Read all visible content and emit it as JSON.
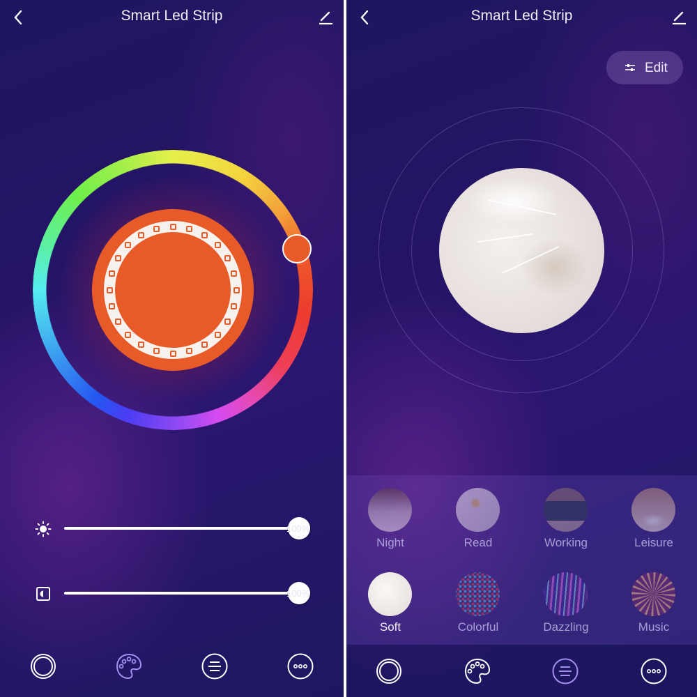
{
  "left": {
    "header": {
      "title": "Smart Led Strip",
      "back_icon": "chevron-left-icon",
      "edit_icon": "pencil-icon"
    },
    "color_wheel": {
      "selected_color": "#e85a27",
      "led_count": 24
    },
    "sliders": [
      {
        "icon": "sun-brightness-icon",
        "value_percent": 100,
        "label": "100%"
      },
      {
        "icon": "contrast-icon",
        "value_percent": 100,
        "label": "100%"
      }
    ],
    "tabs": [
      {
        "name": "tab-light",
        "icon": "ring-icon"
      },
      {
        "name": "tab-color",
        "icon": "palette-icon"
      },
      {
        "name": "tab-scene",
        "icon": "list-icon"
      },
      {
        "name": "tab-more",
        "icon": "more-icon"
      }
    ]
  },
  "right": {
    "header": {
      "title": "Smart Led Strip",
      "back_icon": "chevron-left-icon",
      "edit_icon": "pencil-icon"
    },
    "edit_button": {
      "label": "Edit",
      "icon": "sliders-icon"
    },
    "current_scene": "Soft",
    "scenes": [
      {
        "label": "Night",
        "active": false
      },
      {
        "label": "Read",
        "active": false
      },
      {
        "label": "Working",
        "active": false
      },
      {
        "label": "Leisure",
        "active": false
      },
      {
        "label": "Soft",
        "active": true
      },
      {
        "label": "Colorful",
        "active": false
      },
      {
        "label": "Dazzling",
        "active": false
      },
      {
        "label": "Music",
        "active": false
      }
    ],
    "tabs": [
      {
        "name": "tab-light",
        "icon": "ring-icon"
      },
      {
        "name": "tab-color",
        "icon": "palette-icon"
      },
      {
        "name": "tab-scene",
        "icon": "list-icon"
      },
      {
        "name": "tab-more",
        "icon": "more-icon"
      }
    ]
  }
}
